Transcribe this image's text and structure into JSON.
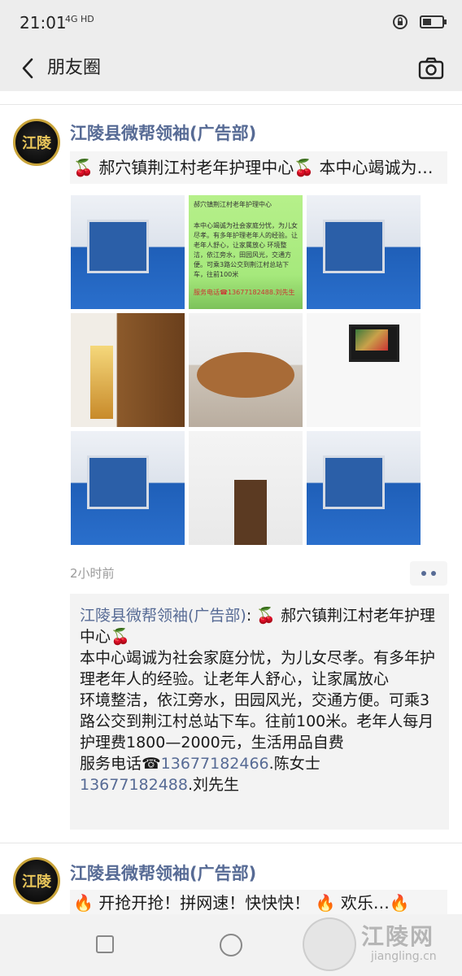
{
  "status_bar": {
    "time": "21:01",
    "network": "4G HD",
    "icons": [
      "orientation-lock-icon",
      "battery-icon"
    ],
    "battery_level": 0.45
  },
  "nav": {
    "back_icon": "‹",
    "title": "朋友圈",
    "camera_icon": "camera-icon"
  },
  "post1": {
    "avatar_text": "江陵",
    "name": "江陵县微帮领袖(广告部)",
    "text": "🍒 郝穴镇荆江村老年护理中心🍒  本中心竭诚为社会家庭分忧，为儿女尽孝…",
    "photos": [
      {
        "kind": "bed",
        "name": "photo-bed-1"
      },
      {
        "kind": "green",
        "name": "photo-info-card"
      },
      {
        "kind": "bed",
        "name": "photo-bed-2"
      },
      {
        "kind": "door",
        "name": "photo-door"
      },
      {
        "kind": "table",
        "name": "photo-table"
      },
      {
        "kind": "tv",
        "name": "photo-tv"
      },
      {
        "kind": "bed",
        "name": "photo-bed-3"
      },
      {
        "kind": "room",
        "name": "photo-room"
      },
      {
        "kind": "bed",
        "name": "photo-bed-4"
      }
    ],
    "info_card": {
      "title": "郝穴镇荆江村老年护理中心",
      "body": "本中心竭诚为社会家庭分忧，为儿女尽孝。有多年护理老年人的经验。让老年人舒心，让家属放心 环境整洁，依江旁水，田园风光，交通方便。可乘3路公交到荆江村总站下车，往前100米",
      "phone": "服务电话☎13677182488.刘先生"
    },
    "time_ago": "2小时前",
    "comment": {
      "author": "江陵县微帮领袖(广告部)",
      "colon": ": ",
      "line1": "🍒 郝穴镇荆江村老年护理中心🍒",
      "line2": "本中心竭诚为社会家庭分忧，为儿女尽孝。有多年护理老年人的经验。让老年人舒心，让家属放心",
      "line3": "环境整洁，依江旁水，田园风光，交通方便。可乘3路公交到荆江村总站下车。往前100米。老年人每月护理费1800—2000元，生活用品自费",
      "phone_prefix": "服务电话☎",
      "phone1": "13677182466",
      "phone1_name": ".陈女士",
      "phone2": "13677182488",
      "phone2_name": ".刘先生"
    }
  },
  "post2": {
    "avatar_text": "江陵",
    "name": "江陵县微帮领袖(广告部)",
    "text": "🔥 开抢开抢！拼网速！快快快！ 🔥 欢乐…🔥"
  },
  "watermark": {
    "text": "江陵网",
    "url": "jiangling.cn"
  }
}
